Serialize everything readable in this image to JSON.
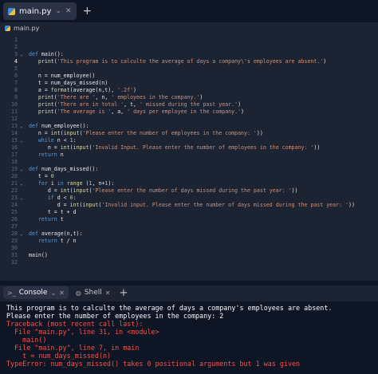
{
  "tab": {
    "label": "main.py"
  },
  "breadcrumb": {
    "file": "main.py"
  },
  "editor": {
    "current_line": 4,
    "lines": [
      {
        "n": "1",
        "t": ""
      },
      {
        "n": "2",
        "t": ""
      },
      {
        "n": "3",
        "t": "def main():"
      },
      {
        "n": "4",
        "t": "   print('This program is to calculte the average of days a company\\'s employees are absent.')"
      },
      {
        "n": "5",
        "t": ""
      },
      {
        "n": "6",
        "t": "   n = num_employee()"
      },
      {
        "n": "7",
        "t": "   t = num_days_missed(n)"
      },
      {
        "n": "8",
        "t": "   a = format(average(n,t), '.2f')"
      },
      {
        "n": "9",
        "t": "   print('There are ', n, ' employees in the company.')"
      },
      {
        "n": "10",
        "t": "   print('There are in total ', t, ' missed during the past year.')"
      },
      {
        "n": "11",
        "t": "   print('The average is ', a, ' days per employee in the company.')"
      },
      {
        "n": "12",
        "t": ""
      },
      {
        "n": "13",
        "t": "def num_employee():"
      },
      {
        "n": "14",
        "t": "   n = int(input('Please enter the number of employees in the company: '))"
      },
      {
        "n": "15",
        "t": "   while n < 1:"
      },
      {
        "n": "16",
        "t": "      n = int(input('Invalid Input. Please enter the number of employees in the company: '))"
      },
      {
        "n": "17",
        "t": "   return n"
      },
      {
        "n": "18",
        "t": ""
      },
      {
        "n": "19",
        "t": "def num_days_missed():"
      },
      {
        "n": "20",
        "t": "   t = 0"
      },
      {
        "n": "21",
        "t": "   for i in range (1, n+1):"
      },
      {
        "n": "22",
        "t": "      d = int(input('Please enter the number of days missed during the past year: '))"
      },
      {
        "n": "23",
        "t": "      if d < 0:"
      },
      {
        "n": "24",
        "t": "         d = int(input('Invalid input. Please enter the number of days missed during the past year: '))"
      },
      {
        "n": "25",
        "t": "      t = t + d"
      },
      {
        "n": "26",
        "t": "   return t"
      },
      {
        "n": "27",
        "t": ""
      },
      {
        "n": "28",
        "t": "def average(n,t):"
      },
      {
        "n": "29",
        "t": "   return t / n"
      },
      {
        "n": "30",
        "t": ""
      },
      {
        "n": "31",
        "t": "main()"
      },
      {
        "n": "32",
        "t": ""
      }
    ]
  },
  "console_tabs": {
    "console": "Console",
    "shell": "Shell"
  },
  "console": {
    "output": [
      "This program is to calculte the average of days a company's employees are absent.",
      "Please enter the number of employees in the company: 2"
    ],
    "error": [
      "Traceback (most recent call last):",
      "  File \"main.py\", line 31, in <module>",
      "    main()",
      "  File \"main.py\", line 7, in main",
      "    t = num_days_missed(n)",
      "TypeError: num_days_missed() takes 0 positional arguments but 1 was given"
    ]
  },
  "colors": {
    "background": "#1c2333",
    "console_bg": "#0e1525",
    "error": "#f85149",
    "keyword": "#569cd6",
    "string": "#ce9178"
  }
}
